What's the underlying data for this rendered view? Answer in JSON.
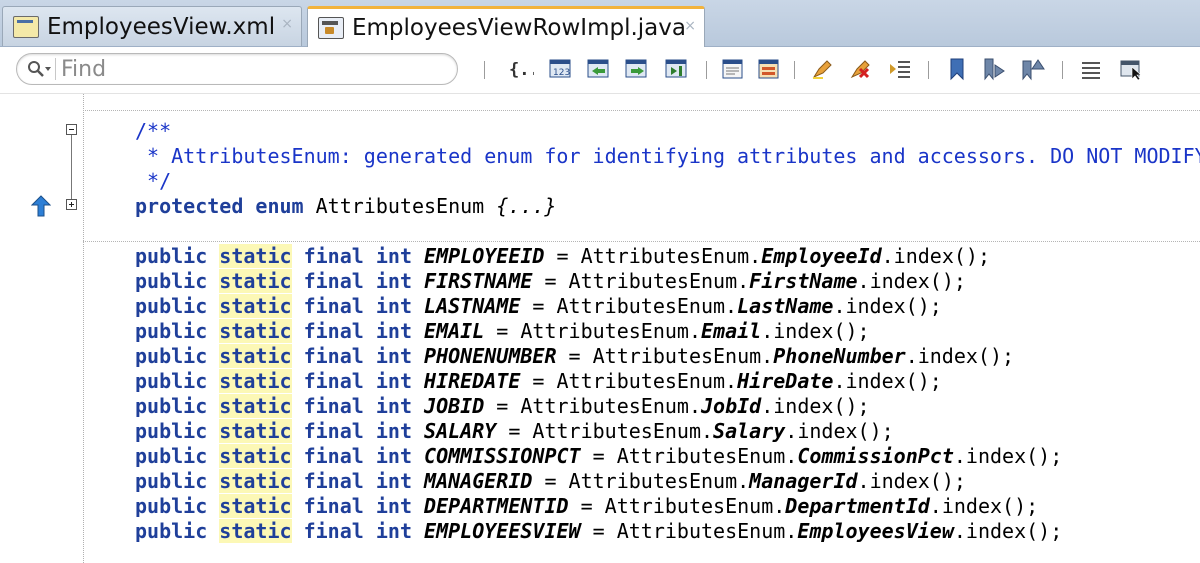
{
  "tabs": [
    {
      "label": "EmployeesView.xml",
      "icon": "xml-file-icon",
      "active": false
    },
    {
      "label": "EmployeesViewRowImpl.java",
      "icon": "java-class-icon",
      "active": true
    }
  ],
  "toolbar": {
    "search_placeholder": "Find",
    "close_glyph": "×"
  },
  "comment": {
    "open": "/**",
    "body": " * AttributesEnum: generated enum for identifying attributes and accessors. DO NOT MODIFY.",
    "close": " */"
  },
  "enum_decl": {
    "kw1": "protected",
    "kw2": "enum",
    "name": "AttributesEnum",
    "folded": "{...}"
  },
  "decl_keywords": {
    "public": "public",
    "static": "static",
    "final": "final",
    "int": "int"
  },
  "fields": [
    {
      "name": "EMPLOYEEID",
      "attr": "EmployeeId"
    },
    {
      "name": "FIRSTNAME",
      "attr": "FirstName"
    },
    {
      "name": "LASTNAME",
      "attr": "LastName"
    },
    {
      "name": "EMAIL",
      "attr": "Email"
    },
    {
      "name": "PHONENUMBER",
      "attr": "PhoneNumber"
    },
    {
      "name": "HIREDATE",
      "attr": "HireDate"
    },
    {
      "name": "JOBID",
      "attr": "JobId"
    },
    {
      "name": "SALARY",
      "attr": "Salary"
    },
    {
      "name": "COMMISSIONPCT",
      "attr": "CommissionPct"
    },
    {
      "name": "MANAGERID",
      "attr": "ManagerId"
    },
    {
      "name": "DEPARTMENTID",
      "attr": "DepartmentId"
    },
    {
      "name": "EMPLOYEESVIEW",
      "attr": "EmployeesView"
    }
  ],
  "code_fragments": {
    "assign": " = ",
    "enum_ref": "AttributesEnum.",
    "index_call": ".index();"
  },
  "colors": {
    "keyword": "#1f3f9a",
    "comment": "#1a35c8",
    "highlight": "#fcf8b6",
    "active_tab_accent": "#f2b33d"
  }
}
